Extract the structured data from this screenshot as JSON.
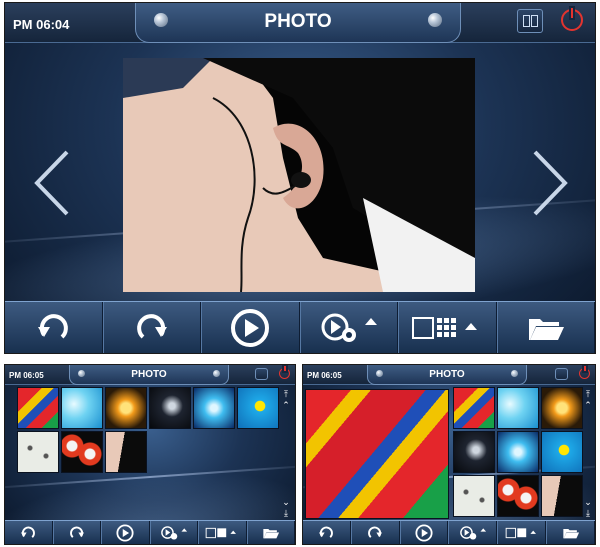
{
  "screens": [
    {
      "id": "main",
      "time": "PM 06:04",
      "title": "PHOTO"
    },
    {
      "id": "grid-left",
      "time": "PM 06:05",
      "title": "PHOTO"
    },
    {
      "id": "grid-right",
      "time": "PM 06:05",
      "title": "PHOTO"
    }
  ],
  "toolbar": {
    "buttons": [
      "rotate-left",
      "rotate-right",
      "play",
      "slideshow-settings",
      "view-mode",
      "open-folder"
    ]
  },
  "colors": {
    "accent": "#e3342f",
    "bar_top": "#3d5a80",
    "bar_bottom": "#18304f",
    "background_dark": "#0a1628"
  }
}
